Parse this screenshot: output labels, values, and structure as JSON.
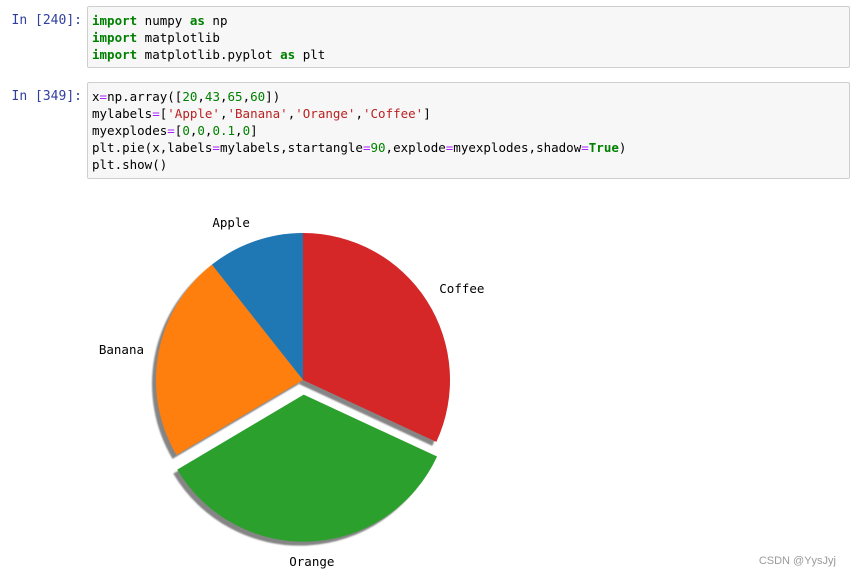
{
  "cells": [
    {
      "prompt": "In  [240]:",
      "lines": [
        [
          [
            "kw",
            "import"
          ],
          [
            "t",
            " numpy "
          ],
          [
            "kw",
            "as"
          ],
          [
            "t",
            " np"
          ]
        ],
        [
          [
            "kw",
            "import"
          ],
          [
            "t",
            " matplotlib"
          ]
        ],
        [
          [
            "kw",
            "import"
          ],
          [
            "t",
            " matplotlib.pyplot "
          ],
          [
            "kw",
            "as"
          ],
          [
            "t",
            " plt"
          ]
        ]
      ]
    },
    {
      "prompt": "In  [349]:",
      "lines": [
        [
          [
            "t",
            "x"
          ],
          [
            "op",
            "="
          ],
          [
            "t",
            "np.array(["
          ],
          [
            "num",
            "20"
          ],
          [
            "t",
            ","
          ],
          [
            "num",
            "43"
          ],
          [
            "t",
            ","
          ],
          [
            "num",
            "65"
          ],
          [
            "t",
            ","
          ],
          [
            "num",
            "60"
          ],
          [
            "t",
            "])"
          ]
        ],
        [
          [
            "t",
            "mylabels"
          ],
          [
            "op",
            "="
          ],
          [
            "t",
            "["
          ],
          [
            "str",
            "'Apple'"
          ],
          [
            "t",
            ","
          ],
          [
            "str",
            "'Banana'"
          ],
          [
            "t",
            ","
          ],
          [
            "str",
            "'Orange'"
          ],
          [
            "t",
            ","
          ],
          [
            "str",
            "'Coffee'"
          ],
          [
            "t",
            "]"
          ]
        ],
        [
          [
            "t",
            "myexplodes"
          ],
          [
            "op",
            "="
          ],
          [
            "t",
            "["
          ],
          [
            "num",
            "0"
          ],
          [
            "t",
            ","
          ],
          [
            "num",
            "0"
          ],
          [
            "t",
            ","
          ],
          [
            "num",
            "0.1"
          ],
          [
            "t",
            ","
          ],
          [
            "num",
            "0"
          ],
          [
            "t",
            "]"
          ]
        ],
        [
          [
            "t",
            "plt.pie(x,labels"
          ],
          [
            "op",
            "="
          ],
          [
            "t",
            "mylabels,startangle"
          ],
          [
            "op",
            "="
          ],
          [
            "num",
            "90"
          ],
          [
            "t",
            ",explode"
          ],
          [
            "op",
            "="
          ],
          [
            "t",
            "myexplodes,shadow"
          ],
          [
            "op",
            "="
          ],
          [
            "bool",
            "True"
          ],
          [
            "t",
            ")"
          ]
        ],
        [
          [
            "t",
            "plt.show()"
          ]
        ]
      ]
    }
  ],
  "chart_data": {
    "type": "pie",
    "categories": [
      "Apple",
      "Banana",
      "Orange",
      "Coffee"
    ],
    "values": [
      20,
      43,
      65,
      60
    ],
    "explode": [
      0,
      0,
      0.1,
      0
    ],
    "startangle": 90,
    "shadow": true,
    "colors": [
      "#1f77b4",
      "#ff7f0e",
      "#2ca02c",
      "#d62728"
    ]
  },
  "watermark": "CSDN @YysJyj"
}
